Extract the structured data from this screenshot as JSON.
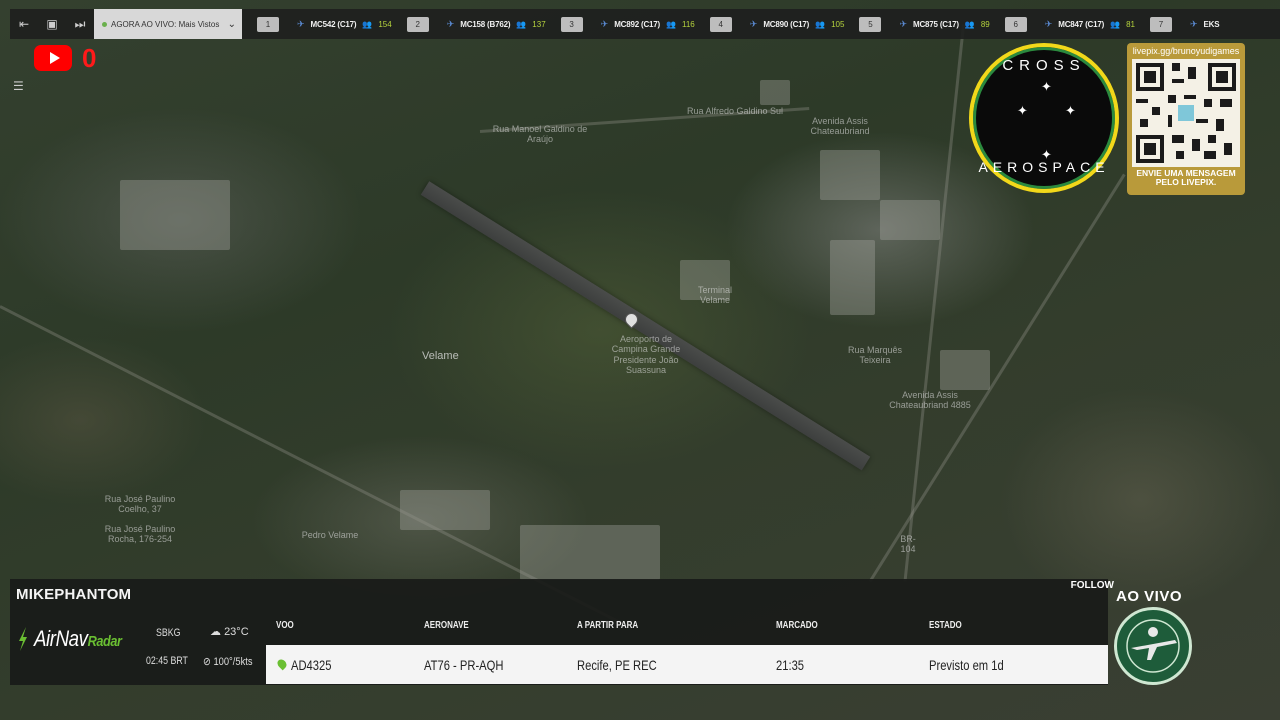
{
  "topbar": {
    "icons": [
      "collapse-icon",
      "window-icon",
      "skip-icon"
    ],
    "now_live": "AGORA AO VIVO: Mais Vistos",
    "flights": [
      {
        "rank": "1",
        "callsign": "MC542 (C17)",
        "viewers": "154"
      },
      {
        "rank": "2",
        "callsign": "MC158 (B762)",
        "viewers": "137"
      },
      {
        "rank": "3",
        "callsign": "MC892 (C17)",
        "viewers": "116"
      },
      {
        "rank": "4",
        "callsign": "MC890 (C17)",
        "viewers": "105"
      },
      {
        "rank": "5",
        "callsign": "MC875 (C17)",
        "viewers": "89"
      },
      {
        "rank": "6",
        "callsign": "MC847 (C17)",
        "viewers": "81"
      },
      {
        "rank": "7",
        "callsign": "EKS",
        "viewers": ""
      }
    ]
  },
  "youtube": {
    "count": "0"
  },
  "logo": {
    "top_text": "CROSS",
    "bottom_text": "AEROSPACE"
  },
  "qr": {
    "url": "livepix.gg/brunoyudigames",
    "caption_line1": "ENVIE UMA MENSAGEM",
    "caption_line2": "PELO LIVEPIX."
  },
  "map_labels": {
    "velame": "Velame",
    "airport": "Aeroporto de Campina Grande Presidente João Suassuna",
    "street1": "Rua Manoel Galdino de Araújo",
    "street2": "Avenida Assis Chateaubriand",
    "street3": "Avenida Assis Chateaubriand 4885",
    "street4": "Rua José Paulino Coelho, 37",
    "street5": "Rua José Paulino Rocha, 176-254",
    "street6": "Rua Marquês Teixeira",
    "street7": "BR-104",
    "terminal": "Terminal Velame",
    "street8": "Pedro Velame",
    "street9": "Rua Alfredo Galdino Sul"
  },
  "panel": {
    "username": "MIKEPHANTOM",
    "follow": "FOLLOW",
    "brand_main": "AirNav",
    "brand_sub": "Radar",
    "airport_code": "SBKG",
    "local_time": "02:45 BRT",
    "temperature": "23°C",
    "wind": "100°/5kts",
    "headers": {
      "flight": "VOO",
      "aircraft": "AERONAVE",
      "route": "A PARTIR PARA",
      "scheduled": "MARCADO",
      "status": "ESTADO"
    },
    "row": {
      "flight": "AD4325",
      "aircraft": "AT76 - PR-AQH",
      "route": "Recife, PE REC",
      "scheduled": "21:35",
      "status": "Previsto em 1d"
    }
  },
  "live": {
    "label": "AO VIVO"
  },
  "colors": {
    "accent_green": "#6abf32",
    "live_red": "#ff0000",
    "viewer_green": "#b5d33d",
    "logo_gold": "#f2d81a"
  }
}
